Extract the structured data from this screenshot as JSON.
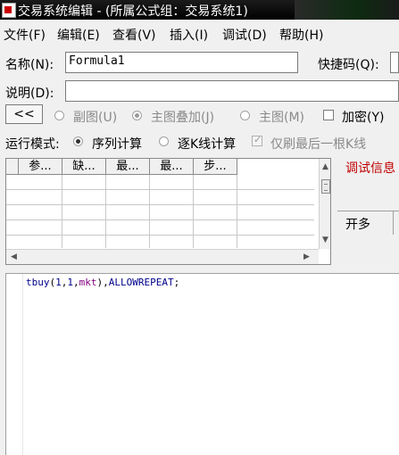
{
  "window": {
    "title": "交易系统编辑 - (所属公式组：交易系统1)"
  },
  "menu": [
    "文件(F)",
    "编辑(E)",
    "查看(V)",
    "插入(I)",
    "调试(D)",
    "帮助(H)"
  ],
  "form": {
    "name_label": "名称(N):",
    "name_value": "Formula1",
    "shortcut_label": "快捷码(Q):",
    "desc_label": "说明(D):",
    "desc_value": ""
  },
  "chart_options": {
    "back_button": "<<",
    "sub_chart": "副图(U)",
    "main_overlay": "主图叠加(J)",
    "main_chart": "主图(M)",
    "encrypt": "加密(Y)",
    "selected": "main_overlay"
  },
  "run_mode": {
    "label": "运行模式:",
    "sequential": "序列计算",
    "per_bar": "逐K线计算",
    "last_bar_only": "仅刷最后一根K线",
    "selected": "sequential"
  },
  "param_table": {
    "headers": [
      "参...",
      "缺...",
      "最...",
      "最...",
      "步..."
    ],
    "rows": [
      [
        "",
        "",
        "",
        "",
        ""
      ],
      [
        "",
        "",
        "",
        "",
        ""
      ],
      [
        "",
        "",
        "",
        "",
        ""
      ],
      [
        "",
        "",
        "",
        "",
        ""
      ],
      [
        "",
        "",
        "",
        "",
        ""
      ]
    ]
  },
  "debug": {
    "label": "调试信息",
    "panel_cell": "开多"
  },
  "code": {
    "line1": [
      {
        "t": "tbuy",
        "c": "blue"
      },
      {
        "t": "(",
        "c": "black"
      },
      {
        "t": "1",
        "c": "num"
      },
      {
        "t": ",",
        "c": "black"
      },
      {
        "t": "1",
        "c": "num"
      },
      {
        "t": ",",
        "c": "black"
      },
      {
        "t": "mkt",
        "c": "purple"
      },
      {
        "t": "),",
        "c": "black"
      },
      {
        "t": "ALLOWREPEAT",
        "c": "blue"
      },
      {
        "t": ";",
        "c": "black"
      }
    ]
  }
}
